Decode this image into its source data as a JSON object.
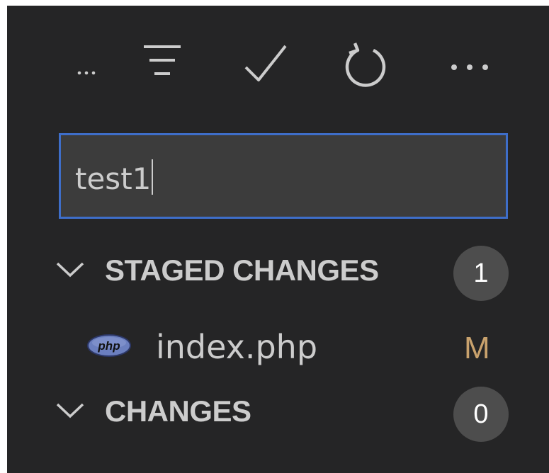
{
  "toolbar": {
    "buttons": [
      {
        "name": "overflow-ellipsis-icon"
      },
      {
        "name": "filter-icon"
      },
      {
        "name": "check-icon"
      },
      {
        "name": "refresh-icon"
      },
      {
        "name": "more-actions-icon"
      }
    ]
  },
  "commit_message": {
    "value": "test1"
  },
  "staged_section": {
    "title": "STAGED CHANGES",
    "count": "1",
    "files": [
      {
        "name": "index.php",
        "status": "M",
        "status_color": "#c9a26d",
        "icon": "php-file-icon",
        "icon_label": "php"
      }
    ]
  },
  "changes_section": {
    "title": "CHANGES",
    "count": "0"
  },
  "colors": {
    "panel_bg": "#252526",
    "input_bg": "#3c3c3c",
    "focus_border": "#3e6ec9",
    "badge_bg": "#4d4d4d",
    "text": "#cccccc"
  }
}
